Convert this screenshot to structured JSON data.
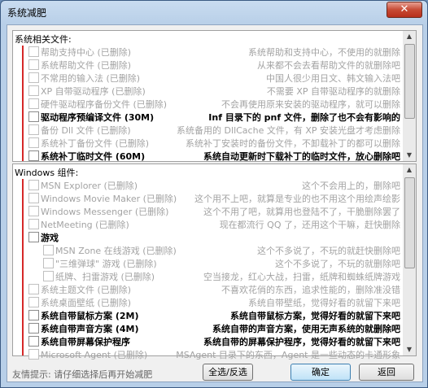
{
  "window": {
    "title": "系统减肥",
    "close_glyph": "✕"
  },
  "group1": {
    "title": "系统相关文件:",
    "items": [
      {
        "name": "帮助支持中心 (已删除)",
        "desc": "系统帮助和支持中心，不使用的就删除",
        "enabled": false
      },
      {
        "name": "系统帮助文件 (已删除)",
        "desc": "从来都不会去看帮助文件的就删除吧",
        "enabled": false
      },
      {
        "name": "不常用的输入法 (已删除)",
        "desc": "中国人很少用日文、韩文输入法吧",
        "enabled": false
      },
      {
        "name": "XP 自带驱动程序 (已删除)",
        "desc": "不需要 XP 自带驱动程序的就删除",
        "enabled": false
      },
      {
        "name": "硬件驱动程序备份文件 (已删除)",
        "desc": "不会再使用原来安装的驱动程序，就可以删除",
        "enabled": false
      },
      {
        "name": "驱动程序预编译文件 (30M)",
        "desc": "Inf 目录下的 pnf 文件，删除了也不会有影响的",
        "enabled": true
      },
      {
        "name": "备份 Dll 文件 (已删除)",
        "desc": "系统备用的 DllCache 文件，有 XP 安装光盘才考虑删除",
        "enabled": false
      },
      {
        "name": "系统补丁备份文件 (已删除)",
        "desc": "系统补丁安装时的备份文件，不卸载补丁的都可以删除",
        "enabled": false
      },
      {
        "name": "系统补丁临时文件 (60M)",
        "desc": "系统自动更新时下载补丁的临时文件，放心删除吧",
        "enabled": true
      }
    ]
  },
  "group2": {
    "title": "Windows 组件:",
    "items": [
      {
        "name": "MSN Explorer (已删除)",
        "desc": "这个不会用上的，删除吧",
        "enabled": false,
        "indent": 0
      },
      {
        "name": "Windows Movie Maker (已删除)",
        "desc": "这个用不上吧，就算是专业的也不用这个用绘声绘影",
        "enabled": false,
        "indent": 0
      },
      {
        "name": "Windows Messenger (已删除)",
        "desc": "这个不用了吧，就算用也登陆不了，干脆删除罢了",
        "enabled": false,
        "indent": 0
      },
      {
        "name": "NetMeeting (已删除)",
        "desc": "现在都流行 QQ 了，还用这个干嘛，赶快删除",
        "enabled": false,
        "indent": 0
      },
      {
        "name": "游戏",
        "desc": "",
        "enabled": true,
        "indent": 0
      },
      {
        "name": "MSN Zone 在线游戏 (已删除)",
        "desc": "这个不多说了，不玩的就赶快删除吧",
        "enabled": false,
        "indent": 1
      },
      {
        "name": "\"三维弹球\" 游戏 (已删除)",
        "desc": "这个不多说了，不玩的就删除吧",
        "enabled": false,
        "indent": 1
      },
      {
        "name": "纸牌、扫雷游戏 (已删除)",
        "desc": "空当接龙，红心大战，扫雷，纸牌和蜘蛛纸牌游戏",
        "enabled": false,
        "indent": 1
      },
      {
        "name": "系统主题文件 (已删除)",
        "desc": "不喜欢花俏的东西，追求性能的，删除准没错",
        "enabled": false,
        "indent": 0
      },
      {
        "name": "系统桌面壁纸 (已删除)",
        "desc": "系统自带壁纸，觉得好看的就留下来吧",
        "enabled": false,
        "indent": 0
      },
      {
        "name": "系统自带鼠标方案 (2M)",
        "desc": "系统自带鼠标方案，觉得好看的就留下来吧",
        "enabled": true,
        "indent": 0
      },
      {
        "name": "系统自带声音方案 (4M)",
        "desc": "系统自带的声音方案，使用无声系统的就删除吧",
        "enabled": true,
        "indent": 0
      },
      {
        "name": "系统自带屏幕保护程序",
        "desc": "系统自带的屏幕保护程序，觉得好看的就留下来吧",
        "enabled": true,
        "indent": 0
      },
      {
        "name": "Microsoft Agent (已删除)",
        "desc": "MSAgent 目录下的东西，Agent 是一些动态的卡通形象",
        "enabled": false,
        "indent": 0
      }
    ]
  },
  "footer": {
    "tip": "友情提示: 请仔细选择后再开始减肥",
    "select_all": "全选/反选",
    "ok": "确定",
    "back": "返回"
  },
  "colors": {
    "annotation_line": "#d62828"
  }
}
